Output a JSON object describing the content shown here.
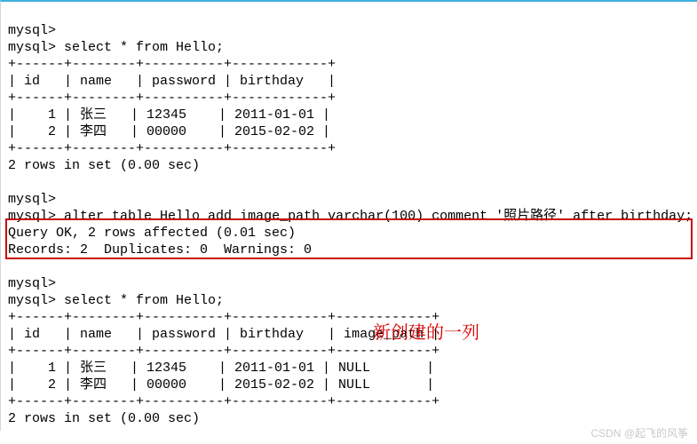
{
  "prompt": "mysql>",
  "query1": "select * from Hello;",
  "table1": {
    "sep": "+------+--------+----------+------------+",
    "header": "| id   | name   | password | birthday   |",
    "rows": [
      "|    1 | 张三   | 12345    | 2011-01-01 |",
      "|    2 | 李四   | 00000    | 2015-02-02 |"
    ]
  },
  "result1": "2 rows in set (0.00 sec)",
  "alter_cmd": "alter table Hello add image_path varchar(100) comment '照片路径' after birthday;",
  "alter_result1": "Query OK, 2 rows affected (0.01 sec)",
  "alter_result2": "Records: 2  Duplicates: 0  Warnings: 0",
  "query2": "select * from Hello;",
  "table2": {
    "sep": "+------+--------+----------+------------+------------+",
    "header": "| id   | name   | password | birthday   | image_path |",
    "rows": [
      "|    1 | 张三   | 12345    | 2011-01-01 | NULL       |",
      "|    2 | 李四   | 00000    | 2015-02-02 | NULL       |"
    ]
  },
  "result2": "2 rows in set (0.00 sec)",
  "annotation": "新创建的一列",
  "watermark": "CSDN @起飞的风筝"
}
